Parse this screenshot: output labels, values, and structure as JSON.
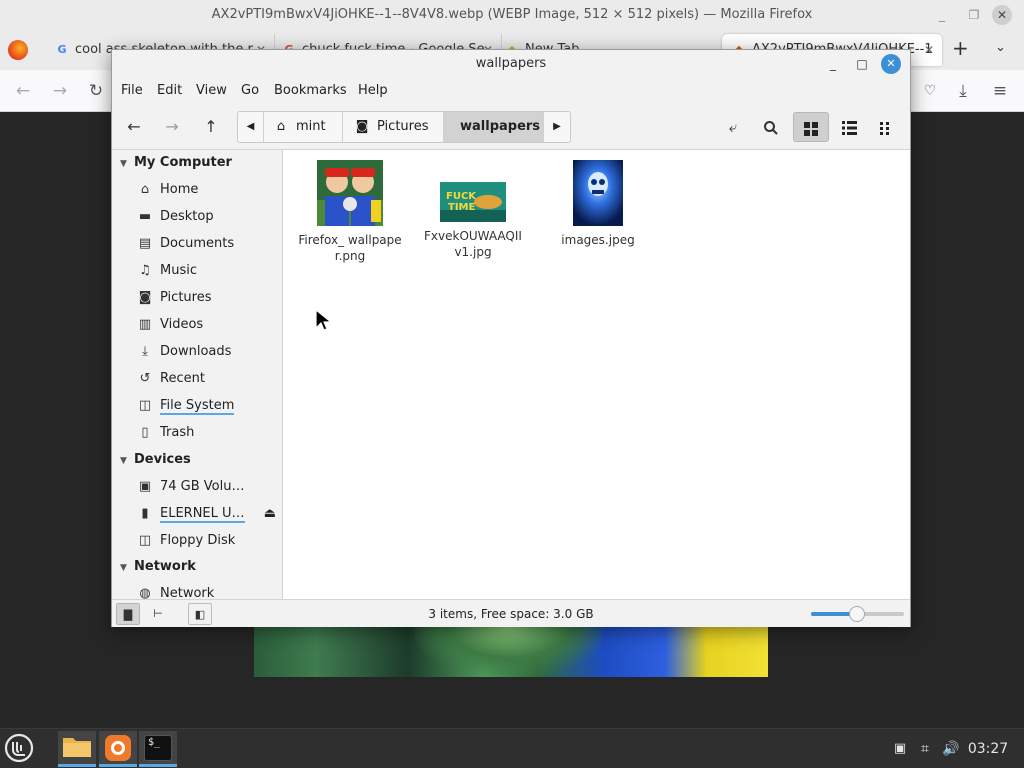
{
  "firefox": {
    "title": "AX2vPTI9mBwxV4JiOHKE--1--8V4V8.webp (WEBP Image, 512 × 512 pixels) — Mozilla Firefox",
    "tabs": [
      {
        "label": "cool ass skeleton with the r"
      },
      {
        "label": "chuck fuck time - Google Se"
      },
      {
        "label": "New Tab"
      },
      {
        "label": "AX2vPTI9mBwxV4JiOHKE--1"
      }
    ]
  },
  "nemo": {
    "title": "wallpapers",
    "menu": [
      "File",
      "Edit",
      "View",
      "Go",
      "Bookmarks",
      "Help"
    ],
    "breadcrumbs": [
      "mint",
      "Pictures",
      "wallpapers"
    ],
    "sidebar": {
      "my_computer": {
        "heading": "My Computer",
        "items": [
          "Home",
          "Desktop",
          "Documents",
          "Music",
          "Pictures",
          "Videos",
          "Downloads",
          "Recent",
          "File System",
          "Trash"
        ]
      },
      "devices": {
        "heading": "Devices",
        "items": [
          "74 GB Volu…",
          "ELERNEL U…",
          "Floppy Disk"
        ]
      },
      "network": {
        "heading": "Network",
        "items": [
          "Network"
        ]
      }
    },
    "files": [
      {
        "name": "Firefox_ wallpaper.png"
      },
      {
        "name": "FxvekOUWAAQIIv1.jpg"
      },
      {
        "name": "images.jpeg"
      }
    ],
    "status": "3 items, Free space: 3.0 GB",
    "zoom_level": 0.49
  },
  "taskbar": {
    "clock": "03:27",
    "terminal_label": "$_"
  },
  "colors": {
    "accent": "#3d8fd6",
    "taskbar": "#2f2f2f"
  }
}
